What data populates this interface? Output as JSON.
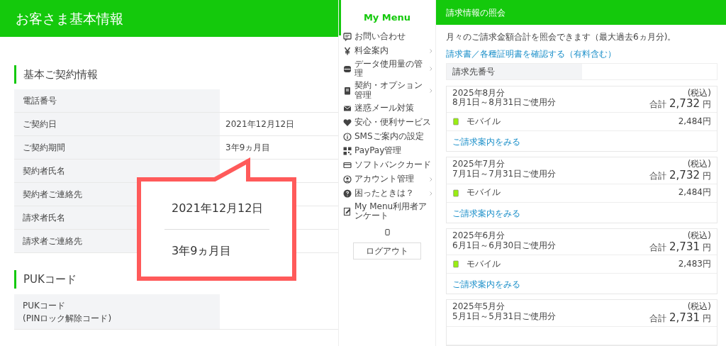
{
  "profile": {
    "title": "お客さま基本情報",
    "sections": [
      {
        "heading": "基本ご契約情報",
        "rows": [
          {
            "label": "電話番号"
          },
          {
            "label": "ご契約日",
            "value": "2021年12月12日"
          },
          {
            "label": "ご契約期間",
            "value": "3年9ヵ月目"
          },
          {
            "label": "契約者氏名"
          },
          {
            "label": "契約者ご連絡先"
          },
          {
            "label": "請求者氏名"
          },
          {
            "label": "請求者ご連絡先"
          }
        ]
      },
      {
        "heading": "PUKコード",
        "rows": [
          {
            "label": "PUKコード\n(PINロック解除コード)"
          }
        ]
      }
    ],
    "callout": {
      "lines": [
        "2021年12月12日",
        "3年9ヵ月目"
      ]
    }
  },
  "menu": {
    "title": "My Menu",
    "items": [
      {
        "label": "お問い合わせ",
        "chevron": false
      },
      {
        "label": "料金案内",
        "chevron": true
      },
      {
        "label": "データ使用量の管理",
        "chevron": true
      },
      {
        "label": "契約・オプション管理",
        "chevron": true
      },
      {
        "label": "迷惑メール対策",
        "chevron": false
      },
      {
        "label": "安心・便利サービス",
        "chevron": false
      },
      {
        "label": "SMSご案内の設定",
        "chevron": false
      },
      {
        "label": "PayPay管理",
        "chevron": false
      },
      {
        "label": "ソフトバンクカード",
        "chevron": false
      },
      {
        "label": "アカウント管理",
        "chevron": true
      },
      {
        "label": "困ったときは？",
        "chevron": true
      },
      {
        "label": "My Menu利用者アンケート",
        "chevron": false
      }
    ],
    "logout": "ログアウト"
  },
  "billing": {
    "title": "請求情報の照会",
    "description": "月々のご請求金額合計を照会できます（最大過去6ヵ月分)。",
    "link": "請求書／各種証明書を確認する（有料含む）",
    "account_label": "請求先番号",
    "bills": [
      {
        "month": "2025年8月分",
        "period": "8月1日～8月31日ご使用分",
        "tax_note": "(税込)",
        "total_label": "合計",
        "total": "2,732",
        "unit": "円",
        "lines": [
          {
            "name": "モバイル",
            "amount": "2,484",
            "unit": "円"
          }
        ],
        "detail_link": "ご請求案内をみる"
      },
      {
        "month": "2025年7月分",
        "period": "7月1日～7月31日ご使用分",
        "tax_note": "(税込)",
        "total_label": "合計",
        "total": "2,732",
        "unit": "円",
        "lines": [
          {
            "name": "モバイル",
            "amount": "2,484",
            "unit": "円"
          }
        ],
        "detail_link": "ご請求案内をみる"
      },
      {
        "month": "2025年6月分",
        "period": "6月1日～6月30日ご使用分",
        "tax_note": "(税込)",
        "total_label": "合計",
        "total": "2,731",
        "unit": "円",
        "lines": [
          {
            "name": "モバイル",
            "amount": "2,483",
            "unit": "円"
          }
        ],
        "detail_link": "ご請求案内をみる"
      },
      {
        "month": "2025年5月分",
        "period": "5月1日～5月31日ご使用分",
        "tax_note": "(税込)",
        "total_label": "合計",
        "total": "2,731",
        "unit": "円"
      }
    ]
  }
}
